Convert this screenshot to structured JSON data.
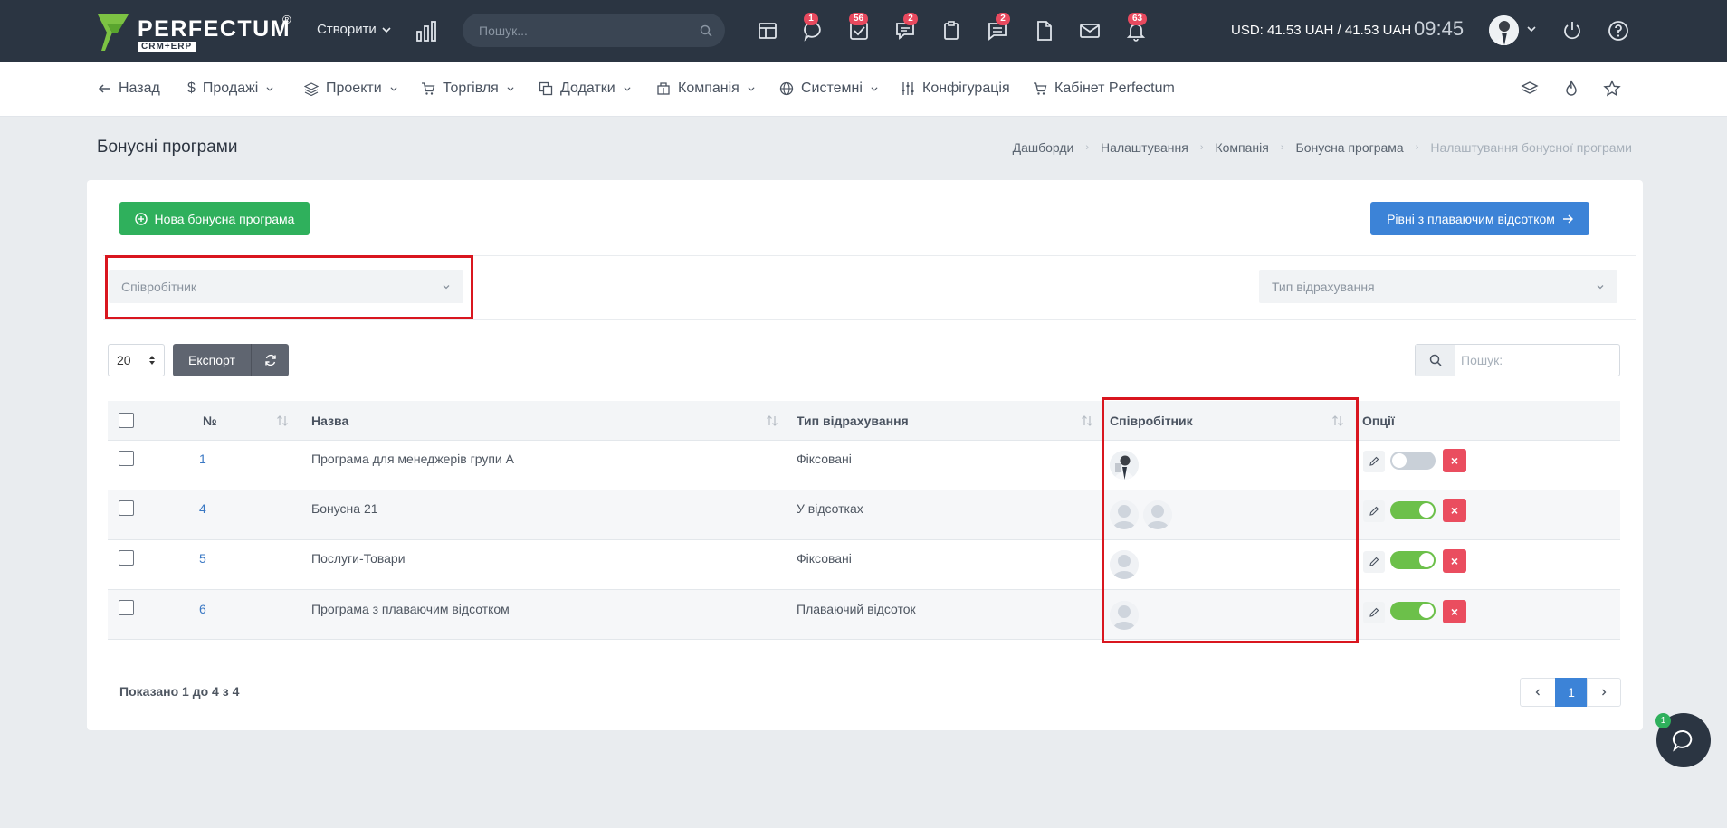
{
  "topbar": {
    "logo_text": "PERFECTUM",
    "logo_reg": "®",
    "logo_sub": "CRM+ERP",
    "create_label": "Створити",
    "search_placeholder": "Пошук...",
    "badges": {
      "chat": "1",
      "tasks": "56",
      "comments": "2",
      "messages": "2",
      "notifications": "63"
    },
    "currency": "USD: 41.53 UAH / 41.53 UAH",
    "time": "09:45"
  },
  "nav": {
    "items": [
      {
        "label": "Назад",
        "icon": "arrow-left-icon"
      },
      {
        "label": "Продажі",
        "icon": "dollar-icon"
      },
      {
        "label": "Проекти",
        "icon": "layers-icon"
      },
      {
        "label": "Торгівля",
        "icon": "cart-icon"
      },
      {
        "label": "Додатки",
        "icon": "copy-icon"
      },
      {
        "label": "Компанія",
        "icon": "building-icon"
      },
      {
        "label": "Системні",
        "icon": "globe-icon"
      },
      {
        "label": "Конфігурація",
        "icon": "sliders-icon"
      },
      {
        "label": "Кабінет Perfectum",
        "icon": "cart-icon"
      }
    ]
  },
  "page": {
    "title": "Бонусні програми",
    "breadcrumbs": [
      "Дашборди",
      "Налаштування",
      "Компанія",
      "Бонусна програма",
      "Налаштування бонусної програми"
    ]
  },
  "actions": {
    "new_program": "Нова бонусна програма",
    "floating_levels": "Рівні з плаваючим відсотком"
  },
  "filters": {
    "employee_placeholder": "Співробітник",
    "accrual_type_placeholder": "Тип відрахування"
  },
  "toolbar": {
    "per_page": "20",
    "export_label": "Експорт",
    "search_placeholder": "Пошук:"
  },
  "table": {
    "headers": {
      "number": "№",
      "name": "Назва",
      "accrual_type": "Тип відрахування",
      "employee": "Співробітник",
      "options": "Опції"
    },
    "rows": [
      {
        "id": "1",
        "name": "Програма для менеджерів групи А",
        "type": "Фіксовані",
        "active": false
      },
      {
        "id": "4",
        "name": "Бонусна 21",
        "type": "У відсотках",
        "active": true
      },
      {
        "id": "5",
        "name": "Послуги-Товари",
        "type": "Фіксовані",
        "active": true
      },
      {
        "id": "6",
        "name": "Програма з плаваючим відсотком",
        "type": "Плаваючий відсоток",
        "active": true
      }
    ]
  },
  "footer": {
    "showing": "Показано 1 до 4 з 4",
    "current_page": "1",
    "chat_badge": "1"
  },
  "colors": {
    "topbar": "#2b3542",
    "green": "#2fb05c",
    "blue": "#3c83d7",
    "danger": "#ea4d5f",
    "highlight": "#d9161f"
  }
}
